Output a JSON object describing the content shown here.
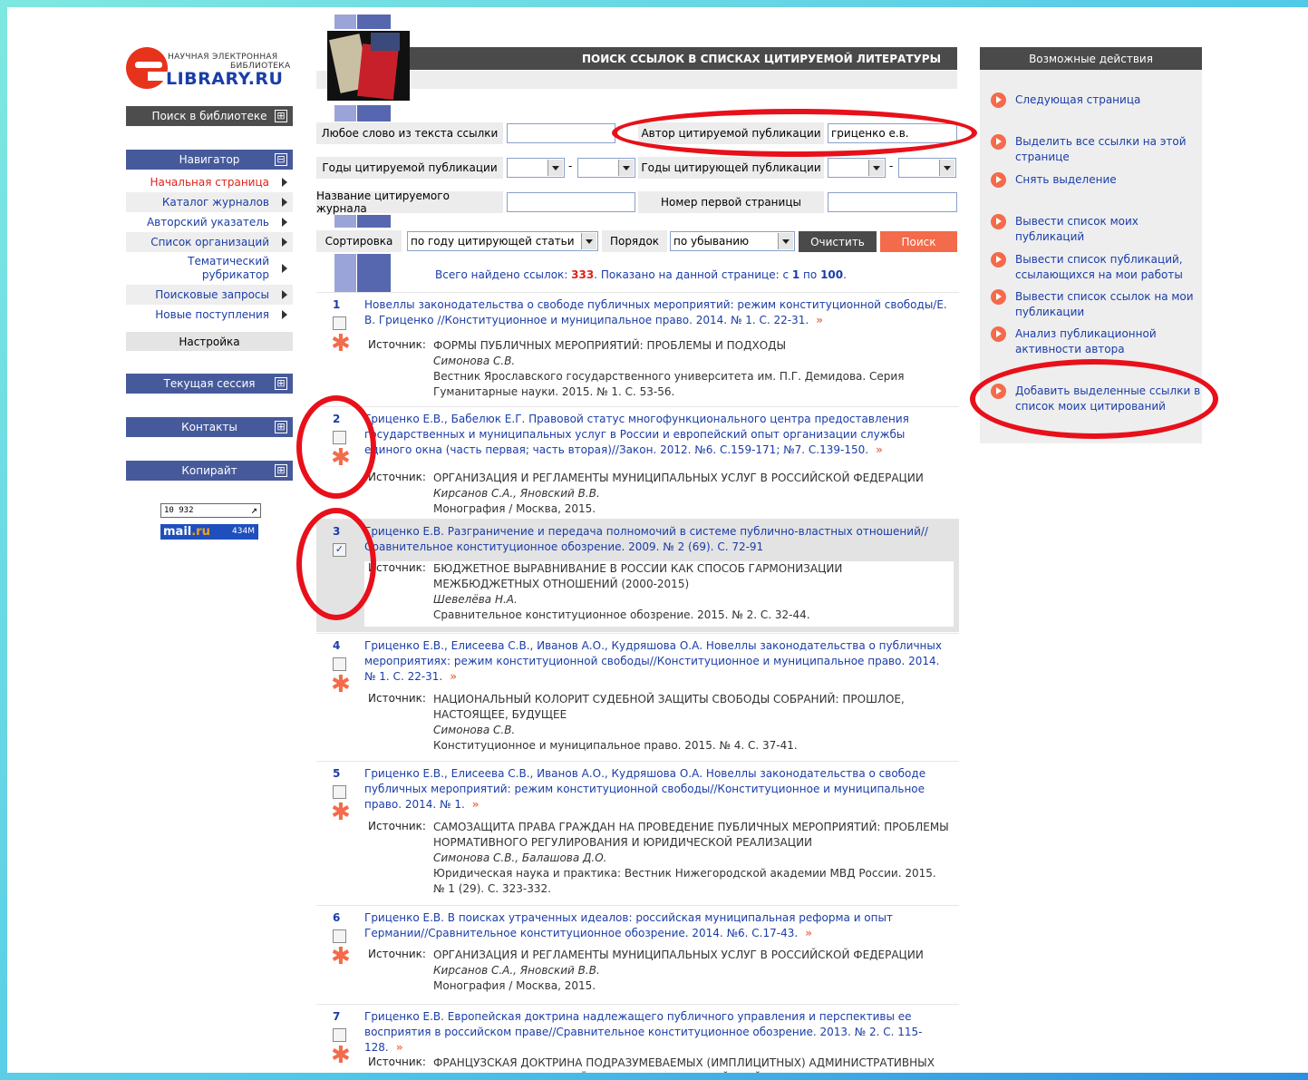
{
  "logo": {
    "line1": "НАУЧНАЯ ЭЛЕКТРОННАЯ",
    "line2": "БИБЛИОТЕКА",
    "name": "LIBRARY.RU"
  },
  "left": {
    "search_lib": "Поиск в библиотеке",
    "navigator": "Навигатор",
    "nav_items": [
      "Начальная страница",
      "Каталог журналов",
      "Авторский указатель",
      "Список организаций",
      "Тематический рубрикатор",
      "Поисковые запросы",
      "Новые поступления"
    ],
    "setup": "Настройка",
    "session": "Текущая сессия",
    "contacts": "Контакты",
    "copyright": "Копирайт",
    "plus": "⊞",
    "minus": "⊟",
    "counter1": "10 932",
    "counter2_a": "mail",
    "counter2_b": ".ru",
    "counter2_n": "434M"
  },
  "header": {
    "title": "ПОИСК ССЫЛОК В СПИСКАХ ЦИТИРУЕМОЙ ЛИТЕРАТУРЫ"
  },
  "form": {
    "any_word_label": "Любое слово из текста ссылки",
    "any_word_value": "",
    "author_label": "Автор цитируемой публикации",
    "author_value": "гриценко е.в.",
    "cited_years_label": "Годы цитируемой публикации",
    "citing_years_label": "Годы цитирующей публикации",
    "dash": "-",
    "journal_label": "Название цитируемого журнала",
    "first_page_label": "Номер первой страницы",
    "sort_label": "Сортировка",
    "sort_value": "по году цитирующей статьи",
    "order_label": "Порядок",
    "order_value": "по убыванию",
    "clear": "Очистить",
    "search": "Поиск"
  },
  "summary": {
    "found_text": "Всего найдено ссылок: ",
    "found": "333",
    "shown_text": ".  Показано на данной странице: с ",
    "from": "1",
    "to_text": " по ",
    "to": "100",
    "end": "."
  },
  "src_label": "Источник:",
  "results": [
    {
      "n": "1",
      "checked": false,
      "title": "Новеллы законодательства о свободе публичных мероприятий: режим конституционной свободы/Е. В. Гриценко //Конституционное и муниципальное право. 2014. № 1. С. 22-31.",
      "src_title": "ФОРМЫ ПУБЛИЧНЫХ МЕРОПРИЯТИЙ: ПРОБЛЕМЫ И ПОДХОДЫ",
      "src_author": "Симонова С.В.",
      "src_pub": "Вестник Ярославского государственного университета им. П.Г. Демидова. Серия Гуманитарные науки. 2015. № 1. С. 53-56."
    },
    {
      "n": "2",
      "checked": false,
      "title": "Гриценко Е.В., Бабелюк Е.Г. Правовой статус многофункционального центра предоставления государственных и муниципальных услуг в России и европейский опыт организации службы единого окна (часть первая; часть вторая)//Закон. 2012. №6. С.159-171; №7. С.139-150.",
      "src_title": "ОРГАНИЗАЦИЯ И РЕГЛАМЕНТЫ МУНИЦИПАЛЬНЫХ УСЛУГ В РОССИЙСКОЙ ФЕДЕРАЦИИ",
      "src_author": "Кирсанов С.А., Яновский В.В.",
      "src_pub": "Монография / Москва, 2015."
    },
    {
      "n": "3",
      "checked": true,
      "title": "Гриценко Е.В. Разграничение и передача полномочий в системе публично-властных отношений//Сравнительное конституционное обозрение. 2009. № 2 (69). С. 72-91",
      "src_title": "БЮДЖЕТНОЕ ВЫРАВНИВАНИЕ В РОССИИ КАК СПОСОБ ГАРМОНИЗАЦИИ МЕЖБЮДЖЕТНЫХ ОТНОШЕНИЙ (2000-2015)",
      "src_author": "Шевелёва Н.А.",
      "src_pub": "Сравнительное конституционное обозрение. 2015. № 2. С. 32-44."
    },
    {
      "n": "4",
      "checked": false,
      "title": "Гриценко Е.В., Елисеева С.В., Иванов А.О., Кудряшова О.А. Новеллы законодательства о публичных мероприятиях: режим конституционной свободы//Конституционное и муниципальное право. 2014. № 1. С. 22-31.",
      "src_title": "НАЦИОНАЛЬНЫЙ КОЛОРИТ СУДЕБНОЙ ЗАЩИТЫ СВОБОДЫ СОБРАНИЙ: ПРОШЛОЕ, НАСТОЯЩЕЕ, БУДУЩЕЕ",
      "src_author": "Симонова С.В.",
      "src_pub": "Конституционное и муниципальное право. 2015. № 4. С. 37-41."
    },
    {
      "n": "5",
      "checked": false,
      "title": "Гриценко Е.В., Елисеева С.В., Иванов А.О., Кудряшова О.А. Новеллы законодательства о свободе публичных мероприятий: режим конституционной свободы//Конституционное и муниципальное право. 2014. № 1.",
      "src_title": "САМОЗАЩИТА ПРАВА ГРАЖДАН НА ПРОВЕДЕНИЕ ПУБЛИЧНЫХ МЕРОПРИЯТИЙ: ПРОБЛЕМЫ НОРМАТИВНОГО РЕГУЛИРОВАНИЯ И ЮРИДИЧЕСКОЙ РЕАЛИЗАЦИИ",
      "src_author": "Симонова С.В., Балашова Д.О.",
      "src_pub": "Юридическая наука и практика: Вестник Нижегородской академии МВД России. 2015. № 1 (29). С. 323-332."
    },
    {
      "n": "6",
      "checked": false,
      "title": "Гриценко Е.В. В поисках утраченных идеалов: российская муниципальная реформа и опыт Германии//Сравнительное конституционное обозрение. 2014. №6. С.17-43.",
      "src_title": "ОРГАНИЗАЦИЯ И РЕГЛАМЕНТЫ МУНИЦИПАЛЬНЫХ УСЛУГ В РОССИЙСКОЙ ФЕДЕРАЦИИ",
      "src_author": "Кирсанов С.А., Яновский В.В.",
      "src_pub": "Монография / Москва, 2015."
    },
    {
      "n": "7",
      "checked": false,
      "title": "Гриценко Е.В. Европейская доктрина надлежащего публичного управления и перспективы ее восприятия в российском праве//Сравнительное конституционное обозрение. 2013. № 2. С. 115-128.",
      "src_title": "ФРАНЦУЗСКАЯ ДОКТРИНА ПОДРАЗУМЕВАЕМЫХ (ИМПЛИЦИТНЫХ) АДМИНИСТРАТИВНЫХ АКТОВ И ПЕРСПЕКТИВЫ ЕЁ ПРИМЕНЕНИЯ В РОССИЙСКОЙ ФЕДЕРАЦИИ",
      "src_author": "",
      "src_pub": ""
    }
  ],
  "icons": {
    "forward": "»",
    "star": "✱",
    "check": "✓"
  },
  "right": {
    "header": "Возможные действия",
    "actions": [
      "Следующая страница",
      "Выделить все ссылки на этой странице",
      "Снять выделение",
      "Вывести список моих публикаций",
      "Вывести список публикаций, ссылающихся на мои работы",
      "Вывести список ссылок на мои публикации",
      "Анализ публикационной активности автора",
      "Добавить выделенные ссылки в список моих цитирований"
    ]
  },
  "colors": {
    "accent": "#f36b4b",
    "navy": "#465a9b",
    "dark": "#4a4a4a",
    "link": "#1a3da8",
    "highlight": "#e8101a"
  }
}
